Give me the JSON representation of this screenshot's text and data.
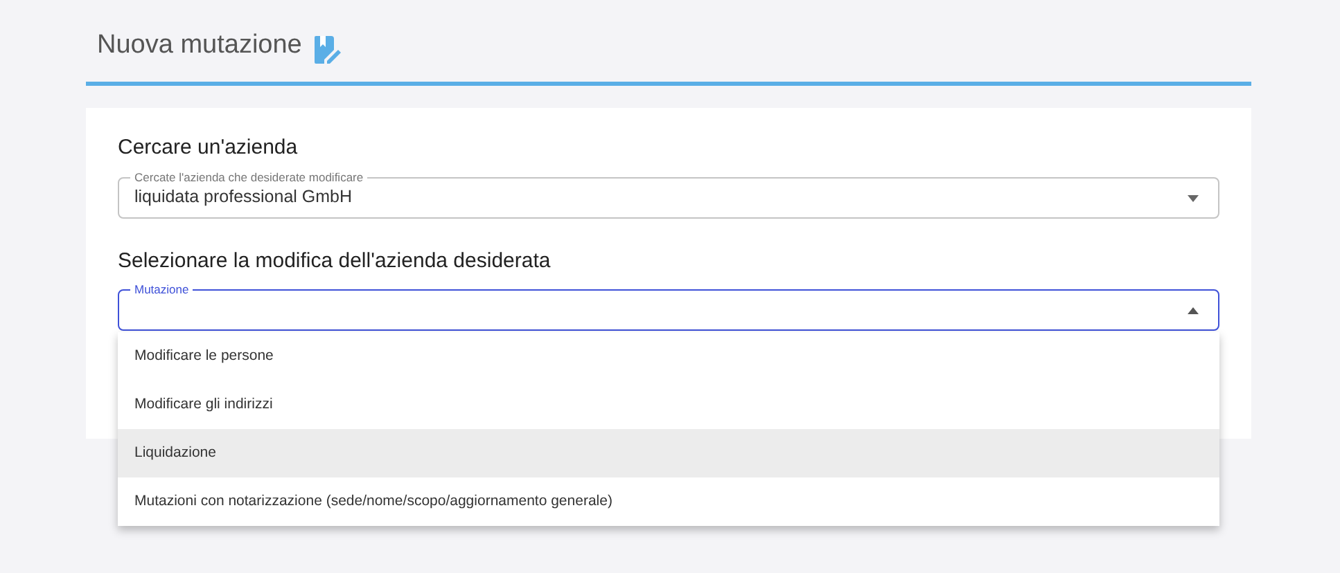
{
  "page": {
    "title": "Nuova mutazione"
  },
  "sections": [
    {
      "heading": "Cercare un'azienda",
      "field": {
        "label": "Cercate l'azienda che desiderate modificare",
        "value": "liquidata professional GmbH",
        "focused": false,
        "expanded": false
      }
    },
    {
      "heading": "Selezionare la modifica dell'azienda desiderata",
      "field": {
        "label": "Mutazione",
        "focused": true,
        "expanded": true
      }
    }
  ],
  "menu": [
    {
      "label": "Modificare le persone",
      "highlighted": false
    },
    {
      "label": "Modificare gli indirizzi",
      "highlighted": false
    },
    {
      "label": "Liquidazione",
      "highlighted": true
    },
    {
      "label": "Mutazioni con notarizzazione (sede/nome/scopo/aggiornamento generale)",
      "highlighted": false
    }
  ]
}
